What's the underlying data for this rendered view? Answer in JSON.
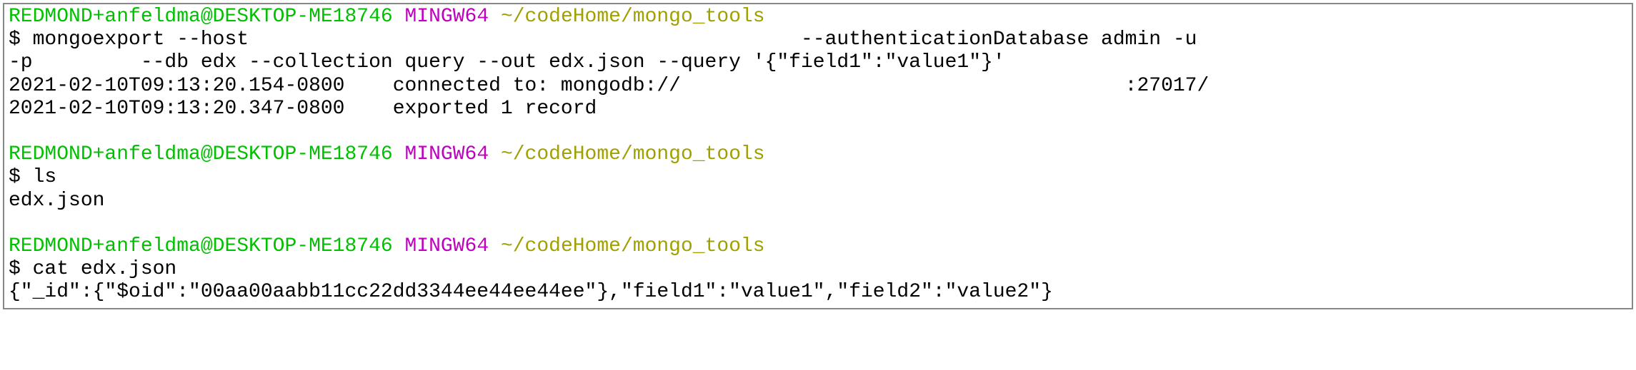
{
  "prompts": [
    {
      "user": "REDMOND+anfeldma@DESKTOP-ME18746",
      "env": "MINGW64",
      "path": "~/codeHome/mongo_tools"
    },
    {
      "user": "REDMOND+anfeldma@DESKTOP-ME18746",
      "env": "MINGW64",
      "path": "~/codeHome/mongo_tools"
    },
    {
      "user": "REDMOND+anfeldma@DESKTOP-ME18746",
      "env": "MINGW64",
      "path": "~/codeHome/mongo_tools"
    }
  ],
  "block1": {
    "cmd_line1": "$ mongoexport --host                                              --authenticationDatabase admin -u",
    "cmd_line2": "-p         --db edx --collection query --out edx.json --query '{\"field1\":\"value1\"}'",
    "out_line1": "2021-02-10T09:13:20.154-0800    connected to: mongodb://                                     :27017/",
    "out_line2": "2021-02-10T09:13:20.347-0800    exported 1 record"
  },
  "block2": {
    "cmd": "$ ls",
    "out": "edx.json"
  },
  "block3": {
    "cmd": "$ cat edx.json",
    "out": "{\"_id\":{\"$oid\":\"00aa00aabb11cc22dd3344ee44ee44ee\"},\"field1\":\"value1\",\"field2\":\"value2\"}"
  },
  "sep": " ",
  "blank": ""
}
